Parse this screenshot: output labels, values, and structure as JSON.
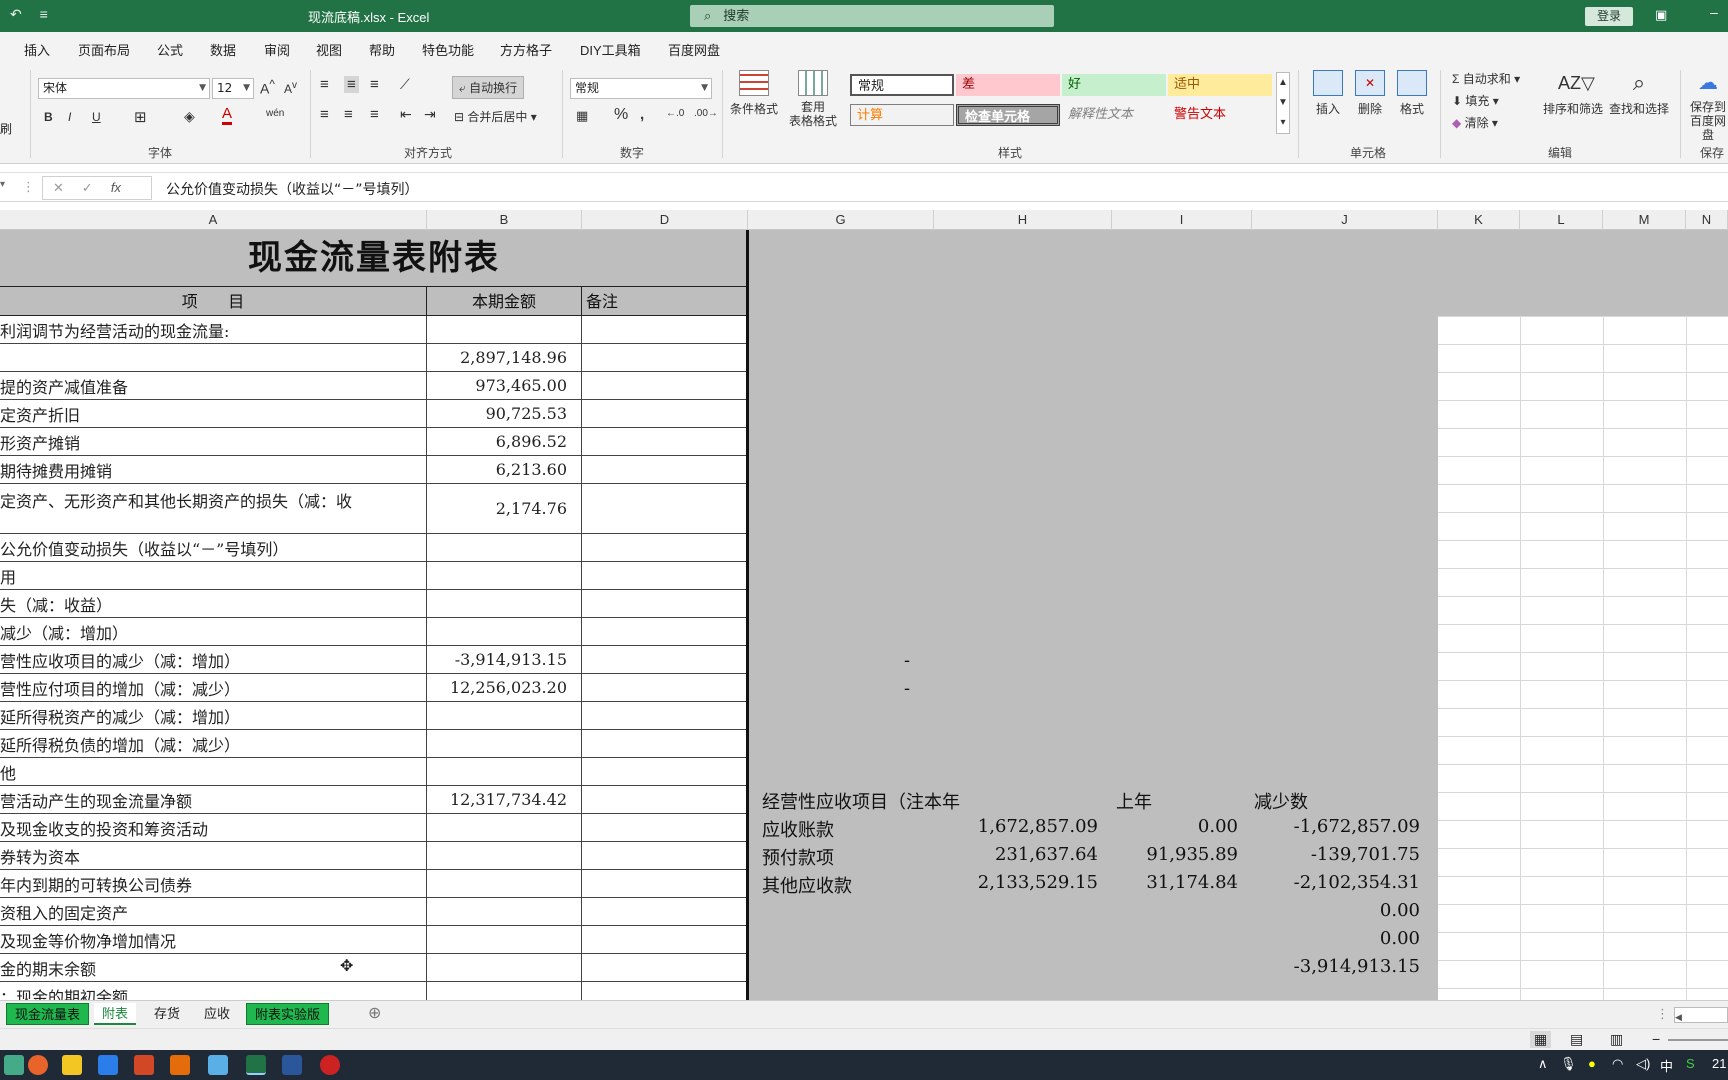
{
  "titlebar": {
    "filename": "现流底稿.xlsx",
    "app": "Excel",
    "title": "现流底稿.xlsx  -  Excel",
    "search_placeholder": "搜索",
    "login": "登录"
  },
  "menu": [
    "插入",
    "页面布局",
    "公式",
    "数据",
    "审阅",
    "视图",
    "帮助",
    "特色功能",
    "方方格子",
    "DIY工具箱",
    "百度网盘"
  ],
  "ribbon": {
    "font_name": "宋体",
    "font_size": "12",
    "wrap_text": "自动换行",
    "merge_center": "合并后居中",
    "number_format": "常规",
    "conditional_format": "条件格式",
    "table_format": "套用\n表格格式",
    "styles": {
      "normal": "常规",
      "bad": "差",
      "good": "好",
      "neutral": "适中",
      "calculation": "计算",
      "check_cell": "检查单元格",
      "explanatory": "解释性文本",
      "warning": "警告文本"
    },
    "insert": "插入",
    "delete": "删除",
    "format": "格式",
    "autosum": "自动求和",
    "fill": "填充",
    "clear": "清除",
    "sort_filter": "排序和筛选",
    "find_select": "查找和选择",
    "save_baidu": "保存到\n百度网盘",
    "groups": {
      "font": "字体",
      "alignment": "对齐方式",
      "number": "数字",
      "styles": "样式",
      "cells": "单元格",
      "editing": "编辑",
      "save": "保存"
    },
    "clipboard_cut": "刷"
  },
  "formula": "公允价值变动损失（收益以“－”号填列）",
  "columns": [
    "A",
    "B",
    "D",
    "G",
    "H",
    "I",
    "J",
    "K",
    "L",
    "M",
    "N"
  ],
  "sheet": {
    "title": "现金流量表附表",
    "header": {
      "item": "项      目",
      "amount": "本期金额",
      "note": "备注"
    },
    "rows": [
      {
        "label": "利润调节为经营活动的现金流量:",
        "amount": ""
      },
      {
        "label": "",
        "amount": "2,897,148.96"
      },
      {
        "label": "提的资产减值准备",
        "amount": "973,465.00",
        "comment": true
      },
      {
        "label": "定资产折旧",
        "amount": "90,725.53"
      },
      {
        "label": "形资产摊销",
        "amount": "6,896.52"
      },
      {
        "label": "期待摊费用摊销",
        "amount": "6,213.60"
      },
      {
        "label": "定资产、无形资产和其他长期资产的损失（减：收",
        "amount": "2,174.76",
        "tall": true
      },
      {
        "label": "公允价值变动损失（收益以“－”号填列）",
        "amount": ""
      },
      {
        "label": "用",
        "amount": "",
        "comment": true
      },
      {
        "label": "失（减：收益）",
        "amount": "",
        "comment": true
      },
      {
        "label": "减少（减：增加）",
        "amount": "",
        "comment": true
      },
      {
        "label": "营性应收项目的减少（减：增加）",
        "amount": "-3,914,913.15"
      },
      {
        "label": "营性应付项目的增加（减：减少）",
        "amount": "12,256,023.20"
      },
      {
        "label": "延所得税资产的减少（减：增加）",
        "amount": ""
      },
      {
        "label": "延所得税负债的增加（减：减少）",
        "amount": ""
      },
      {
        "label": "他",
        "amount": ""
      },
      {
        "label": "营活动产生的现金流量净额",
        "amount": "12,317,734.42"
      },
      {
        "label": "及现金收支的投资和筹资活动",
        "amount": ""
      },
      {
        "label": "券转为资本",
        "amount": ""
      },
      {
        "label": "年内到期的可转换公司债券",
        "amount": ""
      },
      {
        "label": "资租入的固定资产",
        "amount": ""
      },
      {
        "label": "及现金等价物净增加情况",
        "amount": ""
      },
      {
        "label": "金的期末余额",
        "amount": ""
      },
      {
        "label": "：现金的期初余额",
        "amount": ""
      }
    ],
    "dash1": "-",
    "dash2": "-",
    "side": {
      "header": [
        "经营性应收项目（注本年",
        "上年",
        "减少数"
      ],
      "rows": [
        [
          "应收账款",
          "1,672,857.09",
          "0.00",
          "-1,672,857.09"
        ],
        [
          "预付款项",
          "231,637.64",
          "91,935.89",
          "-139,701.75"
        ],
        [
          "其他应收款",
          "2,133,529.15",
          "31,174.84",
          "-2,102,354.31"
        ],
        [
          "",
          "",
          "",
          "0.00"
        ],
        [
          "",
          "",
          "",
          "0.00"
        ],
        [
          "",
          "",
          "",
          "-3,914,913.15"
        ]
      ]
    }
  },
  "tabs": [
    "现金流量表",
    "附表",
    "存货",
    "应收",
    "附表实验版"
  ],
  "colors": {
    "excel_green": "#217346",
    "sheet_gray": "#bebebe",
    "tab_green": "#1fb84e"
  },
  "taskbar": {
    "ime": "中",
    "clock": "21"
  }
}
